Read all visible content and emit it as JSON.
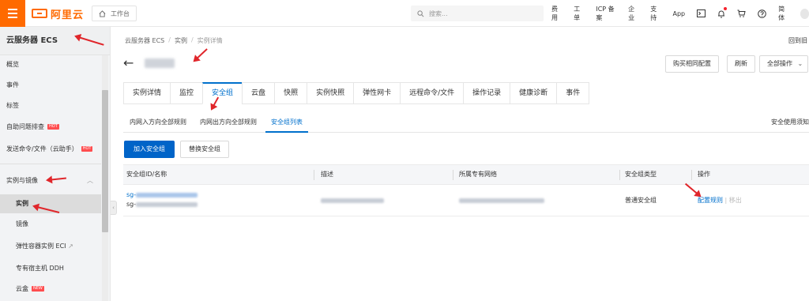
{
  "topbar": {
    "logo_text": "阿里云",
    "workbench_label": "工作台",
    "search_placeholder": "搜索...",
    "nav": [
      "费用",
      "工单",
      "ICP 备案",
      "企业",
      "支持",
      "App"
    ],
    "lang_label": "简体"
  },
  "sidebar": {
    "title": "云服务器 ECS",
    "items": [
      {
        "label": "概览"
      },
      {
        "label": "事件"
      },
      {
        "label": "标签"
      },
      {
        "label": "自助问题排查",
        "badge": "HOT"
      },
      {
        "label": "发送命令/文件（云助手）",
        "badge": "HOT"
      }
    ],
    "group": {
      "label": "实例与镜像"
    },
    "sub_items": [
      {
        "label": "实例"
      },
      {
        "label": "镜像"
      },
      {
        "label": "弹性容器实例 ECI"
      },
      {
        "label": "专有宿主机 DDH"
      },
      {
        "label": "云盒",
        "badge": "NEW"
      }
    ]
  },
  "breadcrumb": [
    "云服务器 ECS",
    "实例",
    "实例详情"
  ],
  "topright_link": "回到旧",
  "header_buttons": {
    "buy_same": "购买相同配置",
    "refresh": "刷新",
    "all_actions": "全部操作"
  },
  "tabs": [
    "实例详情",
    "监控",
    "安全组",
    "云盘",
    "快照",
    "实例快照",
    "弹性网卡",
    "远程命令/文件",
    "操作记录",
    "健康诊断",
    "事件"
  ],
  "subtabs": [
    "内网入方向全部规则",
    "内网出方向全部规则",
    "安全组列表"
  ],
  "security_notice": "安全使用须知",
  "buttons": {
    "add_group": "加入安全组",
    "replace_group": "替换安全组"
  },
  "table": {
    "headers": [
      "安全组ID/名称",
      "描述",
      "所属专有网络",
      "安全组类型",
      "操作"
    ],
    "rows": [
      {
        "id_prefix": "sg-",
        "name_prefix": "sg-",
        "type": "普通安全组",
        "action_primary": "配置规则",
        "action_secondary": "移出"
      }
    ]
  },
  "colors": {
    "brand": "#ff6a00",
    "accent": "#0070cc",
    "primary_button": "#0064c8",
    "annotation": "#e0262b"
  }
}
